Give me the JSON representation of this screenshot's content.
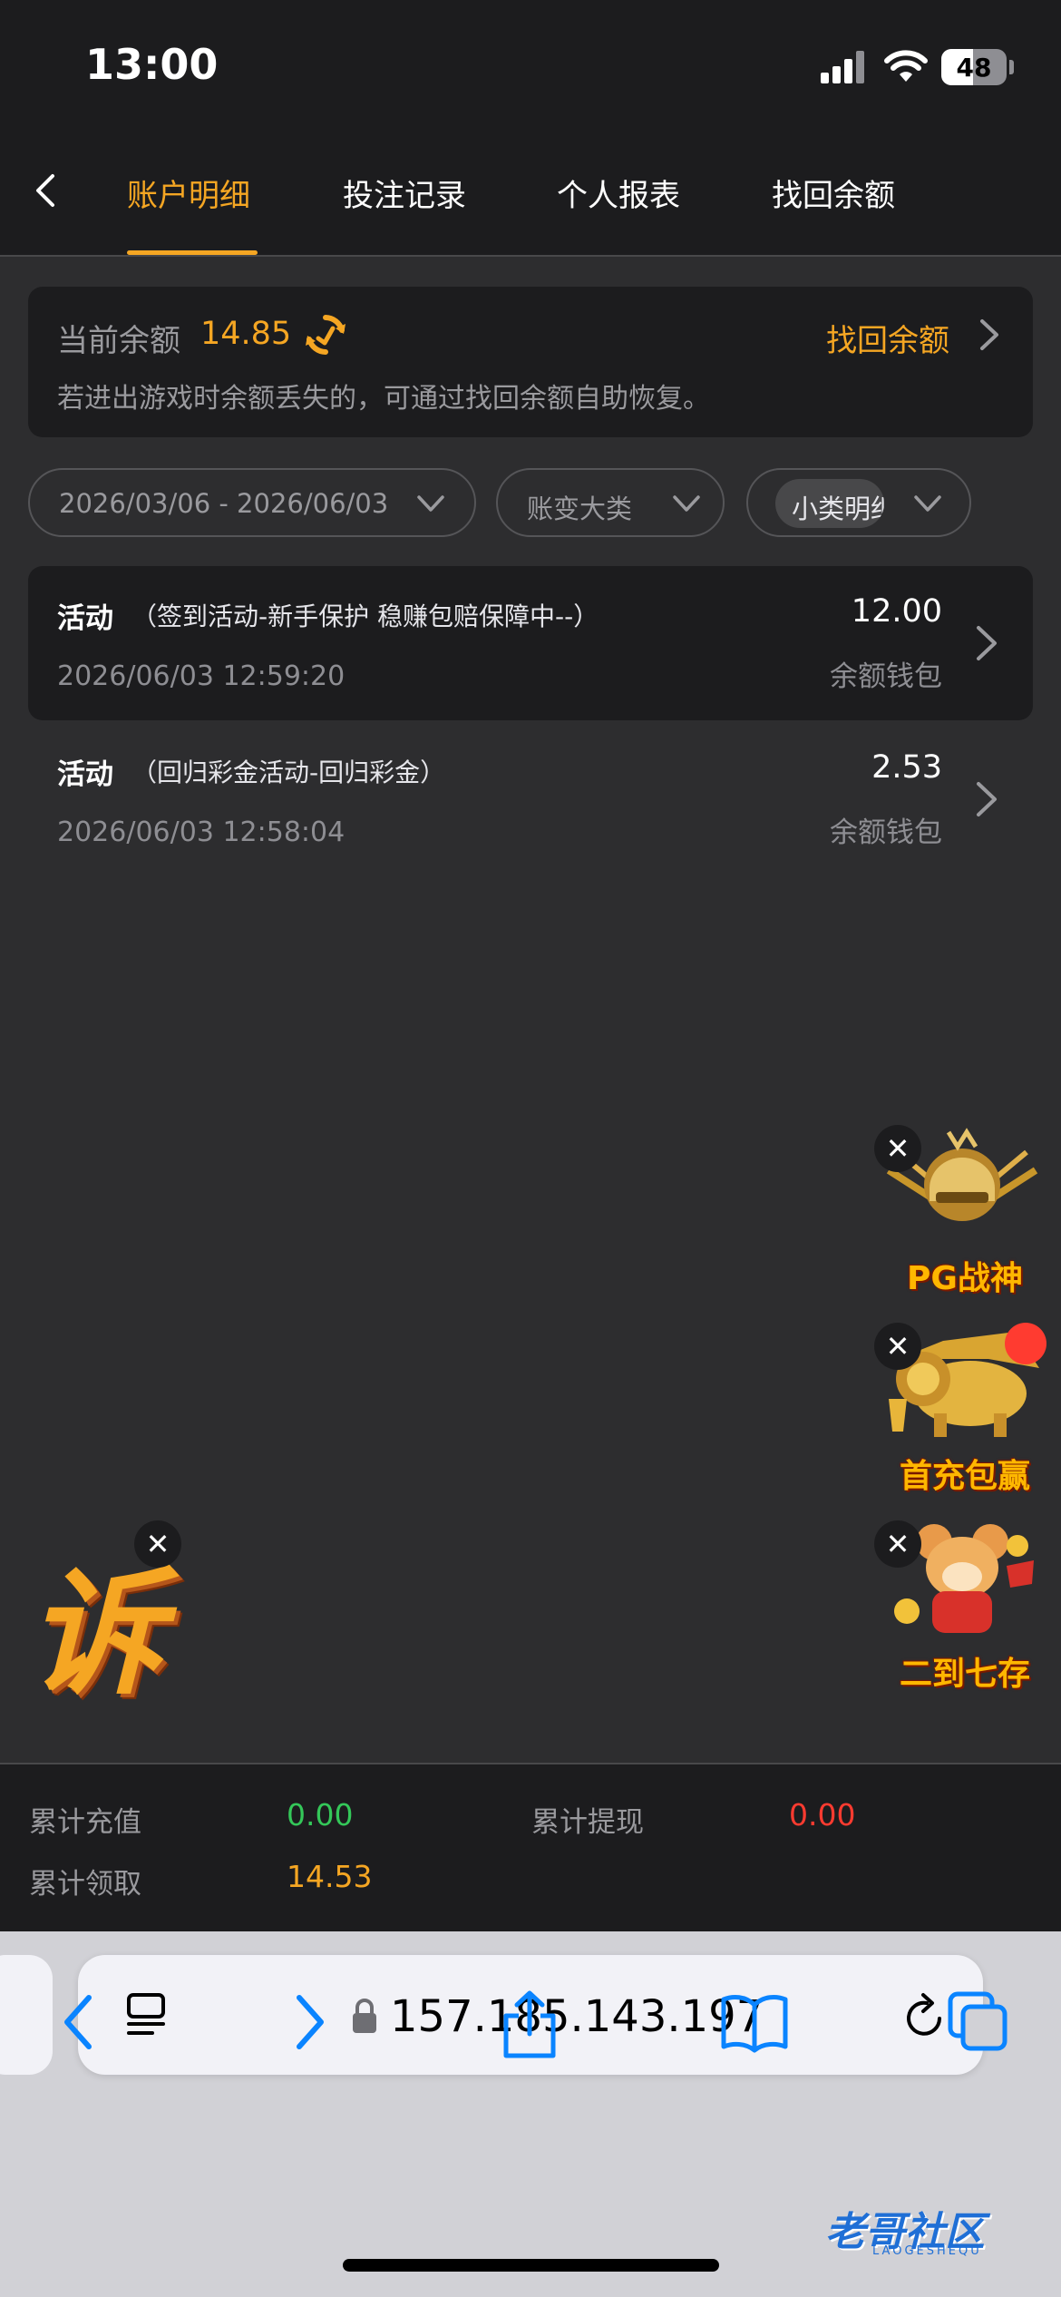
{
  "status_bar": {
    "time": "13:00",
    "battery": "48"
  },
  "header": {
    "tabs": [
      {
        "label": "账户明细"
      },
      {
        "label": "投注记录"
      },
      {
        "label": "个人报表"
      },
      {
        "label": "找回余额"
      }
    ],
    "active_tab": 0
  },
  "balance_card": {
    "label": "当前余额",
    "value": "14.85",
    "recover_link": "找回余额",
    "hint": "若进出游戏时余额丢失的，可通过找回余额自助恢复。"
  },
  "filters": {
    "date_range": "2026/03/06 - 2026/06/03",
    "major_category": "账变大类",
    "minor_category": "小类明细"
  },
  "records": [
    {
      "type": "活动",
      "detail": "（签到活动-新手保护 稳赚包赔保障中--）",
      "time": "2026/06/03 12:59:20",
      "amount": "12.00",
      "wallet": "余额钱包"
    },
    {
      "type": "活动",
      "detail": "（回归彩金活动-回归彩金）",
      "time": "2026/06/03 12:58:04",
      "amount": "2.53",
      "wallet": "余额钱包"
    }
  ],
  "promos": [
    {
      "label": "PG战神"
    },
    {
      "label": "首充包赢"
    },
    {
      "label": "二到七存"
    }
  ],
  "left_promo_glyph": "诉",
  "summary": {
    "deposit_label": "累计充值",
    "deposit_value": "0.00",
    "withdraw_label": "累计提现",
    "withdraw_value": "0.00",
    "claimed_label": "累计领取",
    "claimed_value": "14.53"
  },
  "browser": {
    "url": "157.185.143.197"
  },
  "watermark": {
    "text": "老哥社区",
    "sub": "LAOGESHEQU"
  },
  "colors": {
    "accent": "#f5a623",
    "positive": "#34c759",
    "negative": "#ff3b30",
    "background": "#2d2d2f",
    "card": "#1c1c1e"
  }
}
